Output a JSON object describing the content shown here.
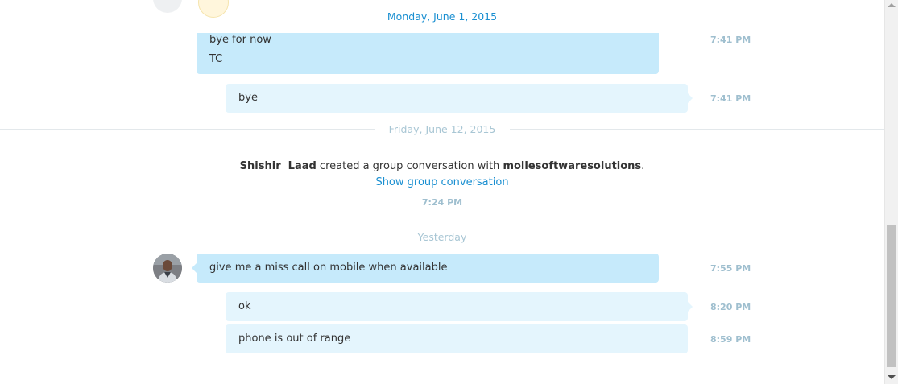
{
  "dates": {
    "first": "Monday, June 1, 2015",
    "second": "Friday, June 12, 2015",
    "third": "Yesterday"
  },
  "messages": [
    {
      "lines": [
        "bye for now",
        "TC"
      ],
      "time": "7:41 PM"
    },
    {
      "lines": [
        "bye"
      ],
      "time": "7:41 PM"
    },
    {
      "lines": [
        "give me a miss call on mobile when available"
      ],
      "time": "7:55 PM"
    },
    {
      "lines": [
        "ok"
      ],
      "time": "8:20 PM"
    },
    {
      "lines": [
        "phone is out of range"
      ],
      "time": "8:59 PM"
    }
  ],
  "event": {
    "actor": "Shishir  Laad",
    "text_middle": " created a group conversation with ",
    "target": "mollesoftwaresolutions",
    "text_end": ".",
    "link": "Show group conversation",
    "time": "7:24 PM"
  },
  "icons": {
    "avatar": "user-avatar-photo",
    "scroll_up": "triangle-up",
    "scroll_down": "triangle-down"
  },
  "colors": {
    "accent": "#1a8fd1",
    "bubble_incoming": "#c6eafb",
    "bubble_outgoing": "#e4f5fd",
    "timestamp": "#9fbfcf"
  }
}
